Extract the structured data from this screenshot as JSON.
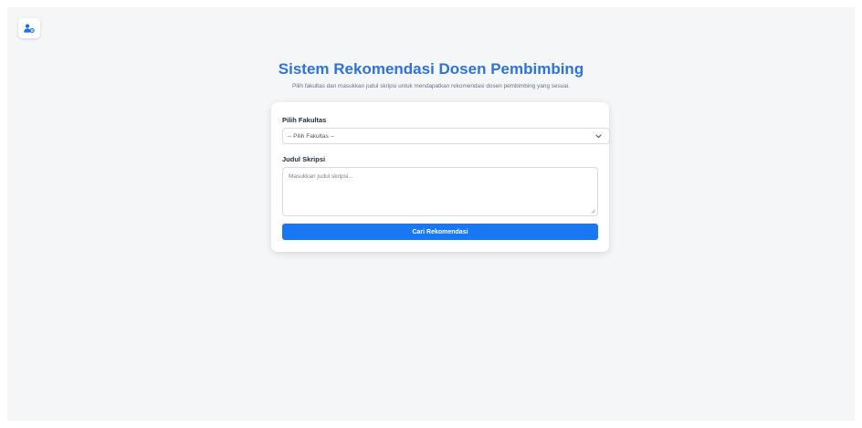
{
  "header": {
    "profile_icon": "user-cog-icon",
    "title": "Sistem Rekomendasi Dosen Pembimbing",
    "subtitle": "Pilih fakultas dan masukkan judul skripsi untuk mendapatkan rekomendasi dosen pembimbing yang sesuai."
  },
  "form": {
    "fakultas_label": "Pilih Fakultas",
    "fakultas_selected": "-- Pilih Fakultas --",
    "judul_label": "Judul Skripsi",
    "judul_placeholder": "Masukkan judul skripsi...",
    "judul_value": "",
    "submit_label": "Cari Rekomendasi"
  },
  "colors": {
    "accent": "#1877f2",
    "title": "#2f73d6",
    "background": "#f5f6f8",
    "card": "#ffffff"
  }
}
